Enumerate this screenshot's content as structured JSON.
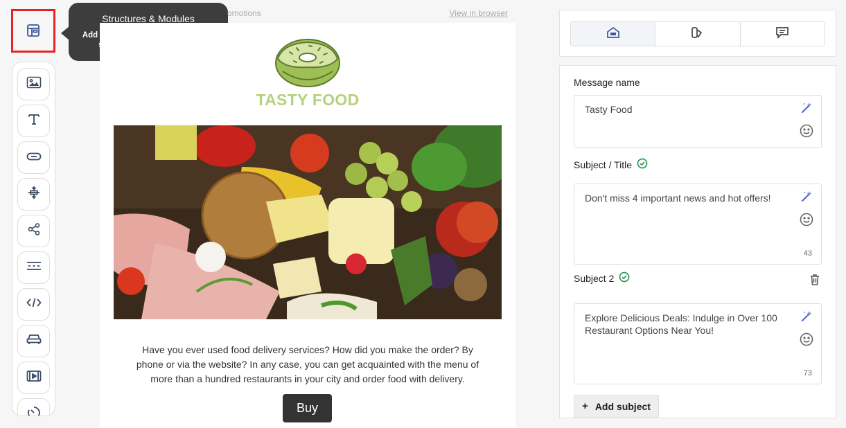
{
  "toolbar": {
    "structures_icon": "structures-modules-icon",
    "tools": [
      {
        "icon": "image-icon"
      },
      {
        "icon": "text-icon"
      },
      {
        "icon": "button-icon"
      },
      {
        "icon": "spacer-icon"
      },
      {
        "icon": "social-share-icon"
      },
      {
        "icon": "menu-icon"
      },
      {
        "icon": "html-code-icon"
      },
      {
        "icon": "banner-icon"
      },
      {
        "icon": "video-icon"
      },
      {
        "icon": "timer-icon"
      }
    ]
  },
  "tooltip": {
    "title": "Structures & Modules",
    "text": "Add template/pre-built modules, or structures with containers"
  },
  "email": {
    "preheader": "omotions",
    "view_in_browser": "View in browser",
    "logo_text": "TASTY FOOD",
    "body_text": "Have you ever used food delivery services? How did you make the order? By phone or via the website? In any case, you can get acquainted with the menu of more than a hundred restaurants in your city and order food with delivery.",
    "button_label": "Buy"
  },
  "panel": {
    "tabs": [
      {
        "icon": "email-settings-icon",
        "active": true
      },
      {
        "icon": "tag-icon",
        "active": false
      },
      {
        "icon": "comment-icon",
        "active": false
      }
    ],
    "message_name_label": "Message name",
    "message_name_value": "Tasty Food",
    "subject_label": "Subject / Title",
    "subject_value": "Don't miss 4 important news and hot offers!",
    "subject_count": "43",
    "subject2_label": "Subject 2",
    "subject2_value": "Explore Delicious Deals: Indulge in Over 100 Restaurant Options Near You!",
    "subject2_count": "73",
    "add_subject_label": "Add subject",
    "add_subject_plus": "+"
  },
  "colors": {
    "accent": "#3b5998",
    "highlight_border": "#e32424",
    "check_green": "#2e9b5e",
    "logo_green": "#b6d17c",
    "tooltip_bg": "#3d3d3d",
    "button_bg": "#333333"
  }
}
